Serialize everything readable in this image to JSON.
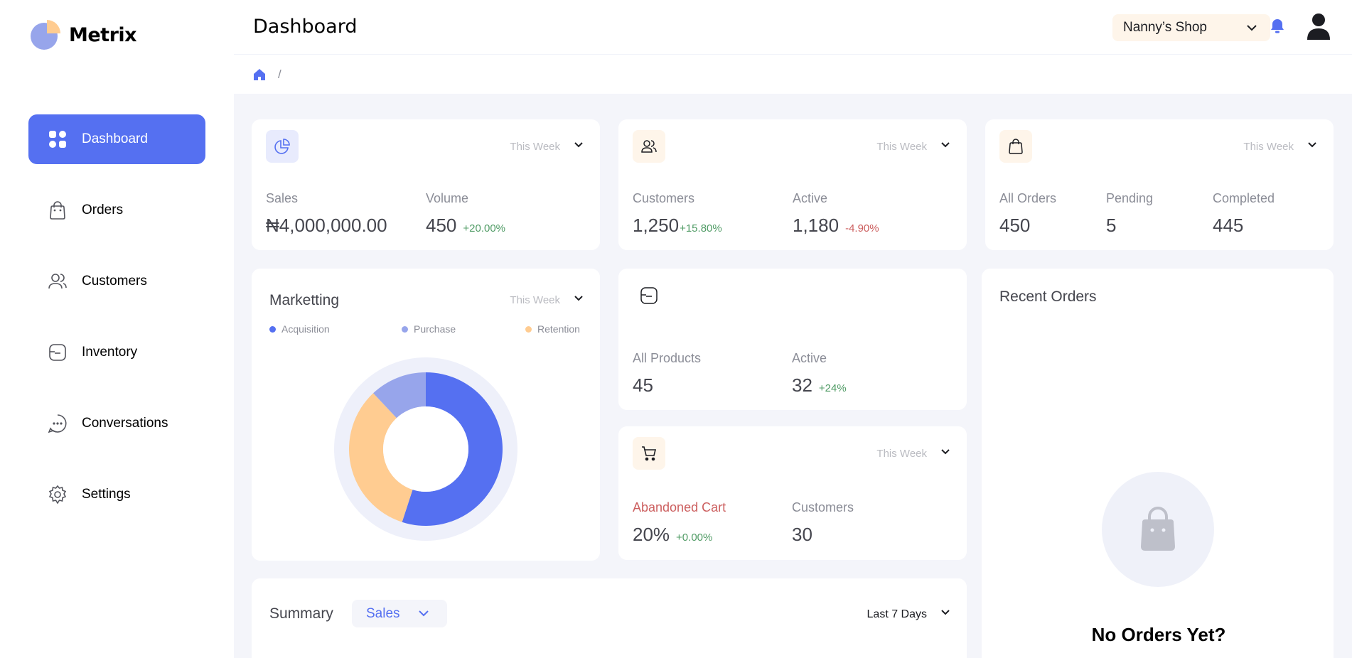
{
  "app": {
    "name": "Metrix"
  },
  "sidebar": {
    "items": [
      {
        "label": "Dashboard",
        "icon": "category-icon",
        "active": true
      },
      {
        "label": "Orders",
        "icon": "bag-icon"
      },
      {
        "label": "Customers",
        "icon": "users-icon"
      },
      {
        "label": "Inventory",
        "icon": "folder-icon"
      },
      {
        "label": "Conversations",
        "icon": "chat-icon"
      },
      {
        "label": "Settings",
        "icon": "gear-icon"
      }
    ]
  },
  "header": {
    "title": "Dashboard",
    "shop": "Nanny’s Shop",
    "breadcrumb_sep": "/"
  },
  "cards": {
    "sales": {
      "period": "This Week",
      "stat1_label": "Sales",
      "stat1_value": "₦4,000,000.00",
      "stat2_label": "Volume",
      "stat2_value": "450",
      "stat2_change": "+20.00%"
    },
    "customers": {
      "period": "This Week",
      "stat1_label": "Customers",
      "stat1_value": "1,250",
      "stat1_change": "+15.80%",
      "stat2_label": "Active",
      "stat2_value": "1,180",
      "stat2_change": "-4.90%"
    },
    "orders": {
      "period": "This Week",
      "stat1_label": "All Orders",
      "stat1_value": "450",
      "stat2_label": "Pending",
      "stat2_value": "5",
      "stat3_label": "Completed",
      "stat3_value": "445"
    },
    "marketing": {
      "title": "Marketting",
      "period": "This Week",
      "legend": [
        "Acquisition",
        "Purchase",
        "Retention"
      ]
    },
    "products": {
      "stat1_label": "All Products",
      "stat1_value": "45",
      "stat2_label": "Active",
      "stat2_value": "32",
      "stat2_change": "+24%"
    },
    "cart": {
      "period": "This Week",
      "stat1_label": "Abandoned Cart",
      "stat1_value": "20%",
      "stat1_change": "+0.00%",
      "stat2_label": "Customers",
      "stat2_value": "30"
    },
    "recent_orders": {
      "title": "Recent Orders",
      "empty_title": "No Orders Yet?"
    },
    "summary": {
      "title": "Summary",
      "metric": "Sales",
      "range": "Last 7 Days"
    }
  },
  "colors": {
    "accent": "#5570f1",
    "acquisition": "#5570f1",
    "purchase": "#97a5eb",
    "retention": "#ffcc91",
    "positive": "#519c66",
    "negative": "#cc5f5f"
  },
  "chart_data": {
    "type": "pie",
    "categories": [
      "Acquisition",
      "Purchase",
      "Retention"
    ],
    "values": [
      55,
      12,
      33
    ]
  }
}
